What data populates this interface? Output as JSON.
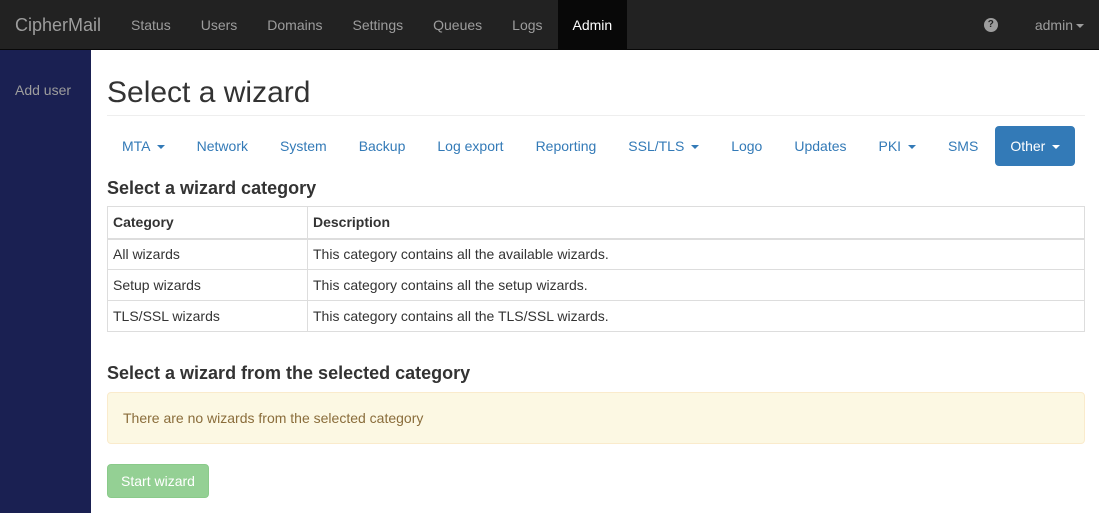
{
  "navbar": {
    "brand": "CipherMail",
    "items": [
      {
        "label": "Status"
      },
      {
        "label": "Users"
      },
      {
        "label": "Domains"
      },
      {
        "label": "Settings"
      },
      {
        "label": "Queues"
      },
      {
        "label": "Logs"
      },
      {
        "label": "Admin",
        "active": true
      }
    ],
    "help_icon": "question-circle-icon",
    "user": "admin"
  },
  "sidebar": {
    "items": [
      {
        "label": "Add user"
      }
    ]
  },
  "main": {
    "title": "Select a wizard",
    "pills": [
      {
        "label": "MTA",
        "dropdown": true
      },
      {
        "label": "Network"
      },
      {
        "label": "System"
      },
      {
        "label": "Backup"
      },
      {
        "label": "Log export"
      },
      {
        "label": "Reporting"
      },
      {
        "label": "SSL/TLS",
        "dropdown": true
      },
      {
        "label": "Logo"
      },
      {
        "label": "Updates"
      },
      {
        "label": "PKI",
        "dropdown": true
      },
      {
        "label": "SMS"
      },
      {
        "label": "Other",
        "dropdown": true,
        "active": true
      }
    ],
    "category_heading": "Select a wizard category",
    "table": {
      "headers": [
        "Category",
        "Description"
      ],
      "rows": [
        [
          "All wizards",
          "This category contains all the available wizards."
        ],
        [
          "Setup wizards",
          "This category contains all the setup wizards."
        ],
        [
          "TLS/SSL wizards",
          "This category contains all the TLS/SSL wizards."
        ]
      ]
    },
    "wizard_heading": "Select a wizard from the selected category",
    "alert": "There are no wizards from the selected category",
    "start_button": "Start wizard"
  },
  "colors": {
    "navbar_bg": "#222222",
    "sidebar_bg": "#1a2052",
    "link": "#337ab7",
    "active_pill": "#337ab7",
    "alert_bg": "#fcf8e3",
    "alert_text": "#8a6d3b",
    "start_button": "#5cb85c"
  }
}
